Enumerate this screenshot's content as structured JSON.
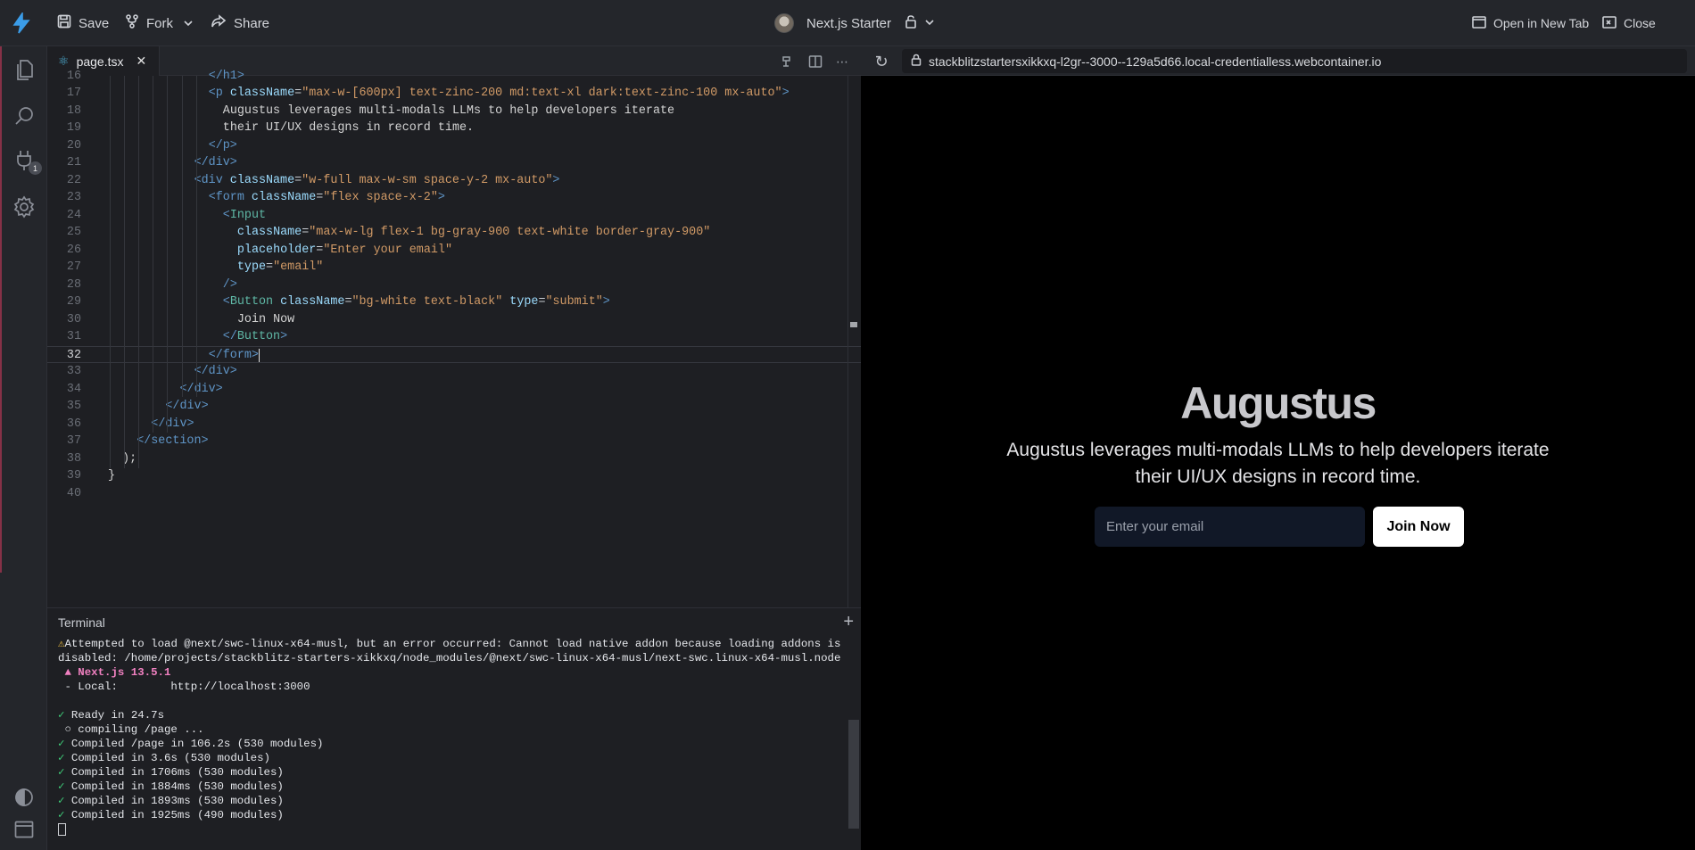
{
  "topbar": {
    "save_label": "Save",
    "fork_label": "Fork",
    "share_label": "Share",
    "project_name": "Next.js Starter",
    "open_new_tab_label": "Open in New Tab",
    "close_label": "Close"
  },
  "activity": {
    "extensions_badge": "1"
  },
  "editor": {
    "tab_label": "page.tsx",
    "current_line": 32,
    "lines": [
      {
        "n": "16",
        "html": "<span class='tag'>&lt;/h1&gt;</span>"
      },
      {
        "n": "17",
        "html": "<span class='tag'>&lt;p</span> <span class='attr'>className</span>=<span class='str'>\"max-w-[600px] text-zinc-200 md:text-xl dark:text-zinc-100 mx-auto\"</span><span class='tag'>&gt;</span>"
      },
      {
        "n": "18",
        "html": "<span class='txt'>Augustus leverages multi-modals LLMs to help developers iterate</span>"
      },
      {
        "n": "19",
        "html": "<span class='txt'>their UI/UX designs in record time.</span>"
      },
      {
        "n": "20",
        "html": "<span class='tag'>&lt;/p&gt;</span>"
      },
      {
        "n": "21",
        "html": "<span class='tag'>&lt;/div&gt;</span>"
      },
      {
        "n": "22",
        "html": "<span class='tag'>&lt;div</span> <span class='attr'>className</span>=<span class='str'>\"w-full max-w-sm space-y-2 mx-auto\"</span><span class='tag'>&gt;</span>"
      },
      {
        "n": "23",
        "html": "<span class='tag'>&lt;form</span> <span class='attr'>className</span>=<span class='str'>\"flex space-x-2\"</span><span class='tag'>&gt;</span>"
      },
      {
        "n": "24",
        "html": "<span class='tag'>&lt;</span><span class='comp'>Input</span>"
      },
      {
        "n": "25",
        "html": "<span class='attr'>className</span>=<span class='str'>\"max-w-lg flex-1 bg-gray-900 text-white border-gray-900\"</span>"
      },
      {
        "n": "26",
        "html": "<span class='attr'>placeholder</span>=<span class='str'>\"Enter your email\"</span>"
      },
      {
        "n": "27",
        "html": "<span class='attr'>type</span>=<span class='str'>\"email\"</span>"
      },
      {
        "n": "28",
        "html": "<span class='tag'>/&gt;</span>"
      },
      {
        "n": "29",
        "html": "<span class='tag'>&lt;</span><span class='comp'>Button</span> <span class='attr'>className</span>=<span class='str'>\"bg-white text-black\"</span> <span class='attr'>type</span>=<span class='str'>\"submit\"</span><span class='tag'>&gt;</span>"
      },
      {
        "n": "30",
        "html": "<span class='txt'>Join Now</span>"
      },
      {
        "n": "31",
        "html": "<span class='tag'>&lt;/</span><span class='comp'>Button</span><span class='tag'>&gt;</span>"
      },
      {
        "n": "32",
        "html": "<span class='tag'>&lt;/form&gt;</span><span style='border-left:1px solid #e0e0e0;'></span>"
      },
      {
        "n": "33",
        "html": "<span class='tag'>&lt;/div&gt;</span>"
      },
      {
        "n": "34",
        "html": "<span class='tag'>&lt;/div&gt;</span>"
      },
      {
        "n": "35",
        "html": "<span class='tag'>&lt;/div&gt;</span>"
      },
      {
        "n": "36",
        "html": "<span class='tag'>&lt;/div&gt;</span>"
      },
      {
        "n": "37",
        "html": "<span class='tag'>&lt;/section&gt;</span>"
      },
      {
        "n": "38",
        "html": "<span class='txt'>);</span>"
      },
      {
        "n": "39",
        "html": "<span class='txt'>}</span>"
      },
      {
        "n": "40",
        "html": ""
      }
    ]
  },
  "terminal": {
    "title": "Terminal",
    "warning": "Attempted to load @next/swc-linux-x64-musl, but an error occurred: Cannot load native addon because loading addons is disabled: /home/projects/stackblitz-starters-xikkxq/node_modules/@next/swc-linux-x64-musl/next-swc.linux-x64-musl.node",
    "version": "▲ Next.js 13.5.1",
    "local": "- Local:        http://localhost:3000",
    "ready": "Ready in 24.7s",
    "compiling": "○ compiling /page ...",
    "compiled": [
      "Compiled /page in 106.2s (530 modules)",
      "Compiled in 3.6s (530 modules)",
      "Compiled in 1706ms (530 modules)",
      "Compiled in 1884ms (530 modules)",
      "Compiled in 1893ms (530 modules)",
      "Compiled in 1925ms (490 modules)"
    ]
  },
  "preview": {
    "url": "stackblitzstartersxikkxq-l2gr--3000--129a5d66.local-credentialless.webcontainer.io",
    "title": "Augustus",
    "subtitle": "Augustus leverages multi-modals LLMs to help developers iterate their UI/UX designs in record time.",
    "email_placeholder": "Enter your email",
    "button_label": "Join Now"
  },
  "colors": {
    "accent": "#3b82f6",
    "preview_bg": "#000000",
    "editor_bg": "#1e1f23"
  }
}
